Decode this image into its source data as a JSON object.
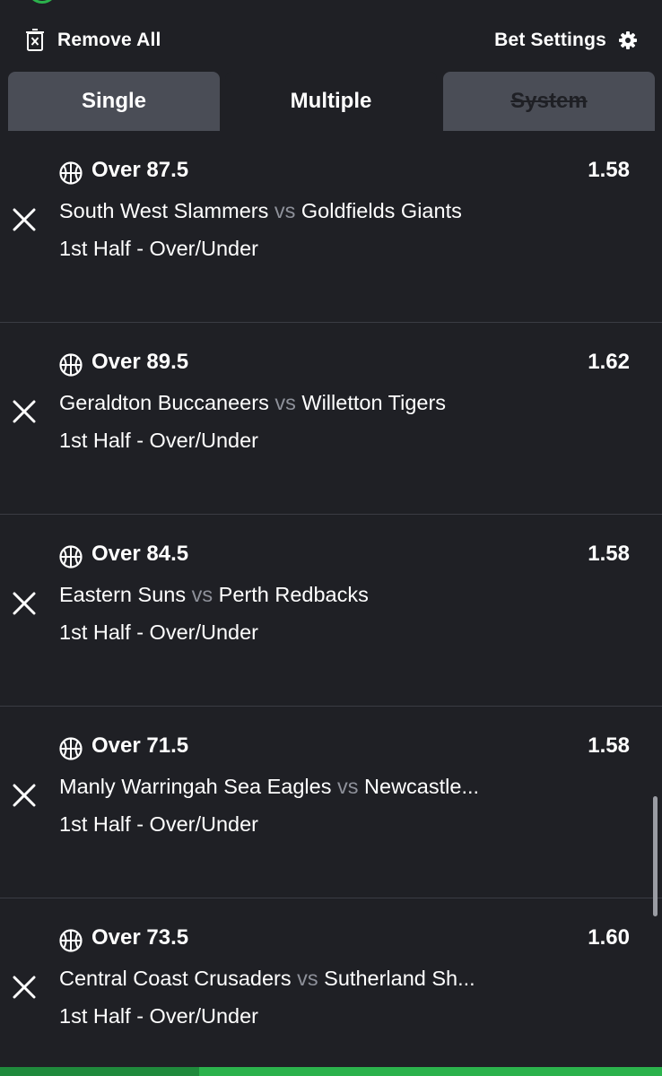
{
  "toolbar": {
    "remove_all_label": "Remove All",
    "bet_settings_label": "Bet Settings"
  },
  "tabs": [
    {
      "label": "Single",
      "active": false,
      "disabled": false
    },
    {
      "label": "Multiple",
      "active": true,
      "disabled": false
    },
    {
      "label": "System",
      "active": false,
      "disabled": true
    }
  ],
  "bets": [
    {
      "selection": "Over 87.5",
      "odds": "1.58",
      "home": "South West Slammers",
      "vs": "vs",
      "away": "Goldfields Giants",
      "market": "1st Half - Over/Under"
    },
    {
      "selection": "Over 89.5",
      "odds": "1.62",
      "home": "Geraldton Buccaneers",
      "vs": "vs",
      "away": "Willetton Tigers",
      "market": "1st Half - Over/Under"
    },
    {
      "selection": "Over 84.5",
      "odds": "1.58",
      "home": "Eastern Suns",
      "vs": "vs",
      "away": "Perth Redbacks",
      "market": "1st Half - Over/Under"
    },
    {
      "selection": "Over 71.5",
      "odds": "1.58",
      "home": "Manly Warringah Sea Eagles",
      "vs": "vs",
      "away": "Newcastle...",
      "market": "1st Half - Over/Under"
    },
    {
      "selection": "Over 73.5",
      "odds": "1.60",
      "home": "Central Coast Crusaders",
      "vs": "vs",
      "away": "Sutherland Sh...",
      "market": "1st Half - Over/Under"
    }
  ],
  "icons": {
    "remove_all": "trash-icon",
    "bet_settings": "gear-icon",
    "sport": "basketball-icon",
    "remove_bet": "close-icon"
  },
  "colors": {
    "background": "#1f2025",
    "tab_inactive": "#4a4d56",
    "divider": "#3a3c43",
    "vs_text": "#8e919a",
    "accent_green": "#2bb24c"
  }
}
